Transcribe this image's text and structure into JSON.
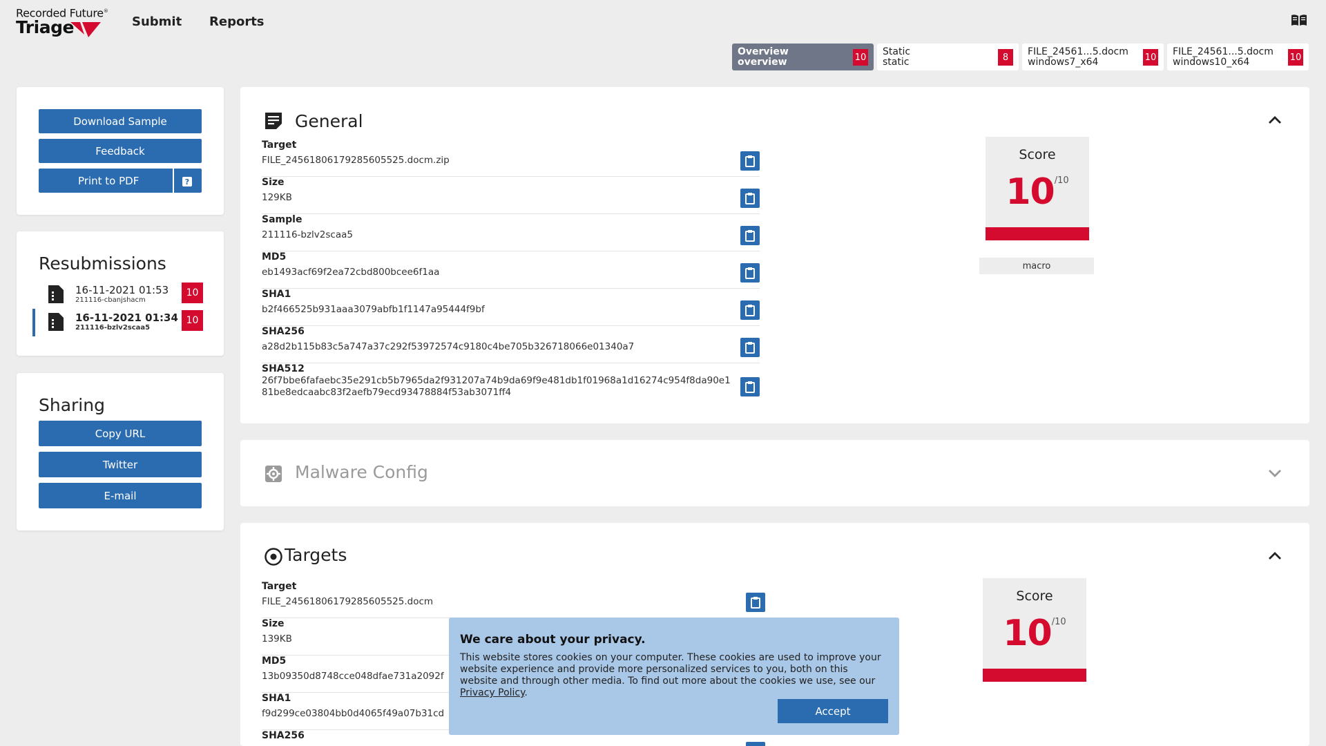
{
  "header": {
    "brand_line1": "Recorded Future",
    "brand_reg": "®",
    "brand_line2": "Triage",
    "nav": [
      "Submit",
      "Reports"
    ]
  },
  "tabs": [
    {
      "line1": "Overview",
      "line2": "overview",
      "badge": "10",
      "active": true
    },
    {
      "line1": "Static",
      "line2": "static",
      "badge": "8",
      "active": false
    },
    {
      "line1": "FILE_24561...5.docm",
      "line2": "windows7_x64",
      "badge": "10",
      "active": false
    },
    {
      "line1": "FILE_24561...5.docm",
      "line2": "windows10_x64",
      "badge": "10",
      "active": false
    }
  ],
  "actions": {
    "download": "Download Sample",
    "feedback": "Feedback",
    "print": "Print to PDF",
    "help": "?"
  },
  "resubmissions": {
    "title": "Resubmissions",
    "items": [
      {
        "date": "16-11-2021 01:53",
        "id": "211116-cbanjshacm",
        "badge": "10",
        "current": false
      },
      {
        "date": "16-11-2021 01:34",
        "id": "211116-bzlv2scaa5",
        "badge": "10",
        "current": true
      }
    ]
  },
  "sharing": {
    "title": "Sharing",
    "copy_url": "Copy URL",
    "twitter": "Twitter",
    "email": "E-mail"
  },
  "general": {
    "title": "General",
    "fields": [
      {
        "label": "Target",
        "value": "FILE_24561806179285605525.docm.zip"
      },
      {
        "label": "Size",
        "value": "129KB"
      },
      {
        "label": "Sample",
        "value": "211116-bzlv2scaa5"
      },
      {
        "label": "MD5",
        "value": "eb1493acf69f2ea72cbd800bcee6f1aa"
      },
      {
        "label": "SHA1",
        "value": "b2f466525b931aaa3079abfb1f1147a95444f9bf"
      },
      {
        "label": "SHA256",
        "value": "a28d2b115b83c5a747a37c292f53972574c9180c4be705b326718066e01340a7"
      },
      {
        "label": "SHA512",
        "value": "26f7bbe6fafaebc35e291cb5b7965da2f931207a74b9da69f9e481db1f01968a1d16274c954f8da90e1",
        "value2": "81be8edcaabc83f2aefb79ecd93478884f53ab3071ff4"
      }
    ],
    "score_label": "Score",
    "score": "10",
    "score_max": "/10",
    "tag": "macro"
  },
  "malware_config": {
    "title": "Malware Config"
  },
  "targets": {
    "title": "Targets",
    "fields": [
      {
        "label": "Target",
        "value": "FILE_24561806179285605525.docm"
      },
      {
        "label": "Size",
        "value": "139KB"
      },
      {
        "label": "MD5",
        "value": "13b09350d8748cce048dfae731a2092f"
      },
      {
        "label": "SHA1",
        "value": "f9d299ce03804bb0d4065f49a07b31cd"
      },
      {
        "label": "SHA256",
        "value": ""
      }
    ],
    "score_label": "Score",
    "score": "10",
    "score_max": "/10"
  },
  "cookie": {
    "title": "We care about your privacy.",
    "body": "This website stores cookies on your computer. These cookies are used to improve your website experience and provide more personalized services to you, both on this website and through other media. To find out more about the cookies we use, see our ",
    "link": "Privacy Policy",
    "end": ".",
    "accept": "Accept"
  },
  "colors": {
    "accent": "#2b6cb0",
    "danger": "#d40b2e",
    "active_tab": "#6e7687",
    "cookie_bg": "#a9c7e6",
    "page_bg": "#ededed"
  }
}
